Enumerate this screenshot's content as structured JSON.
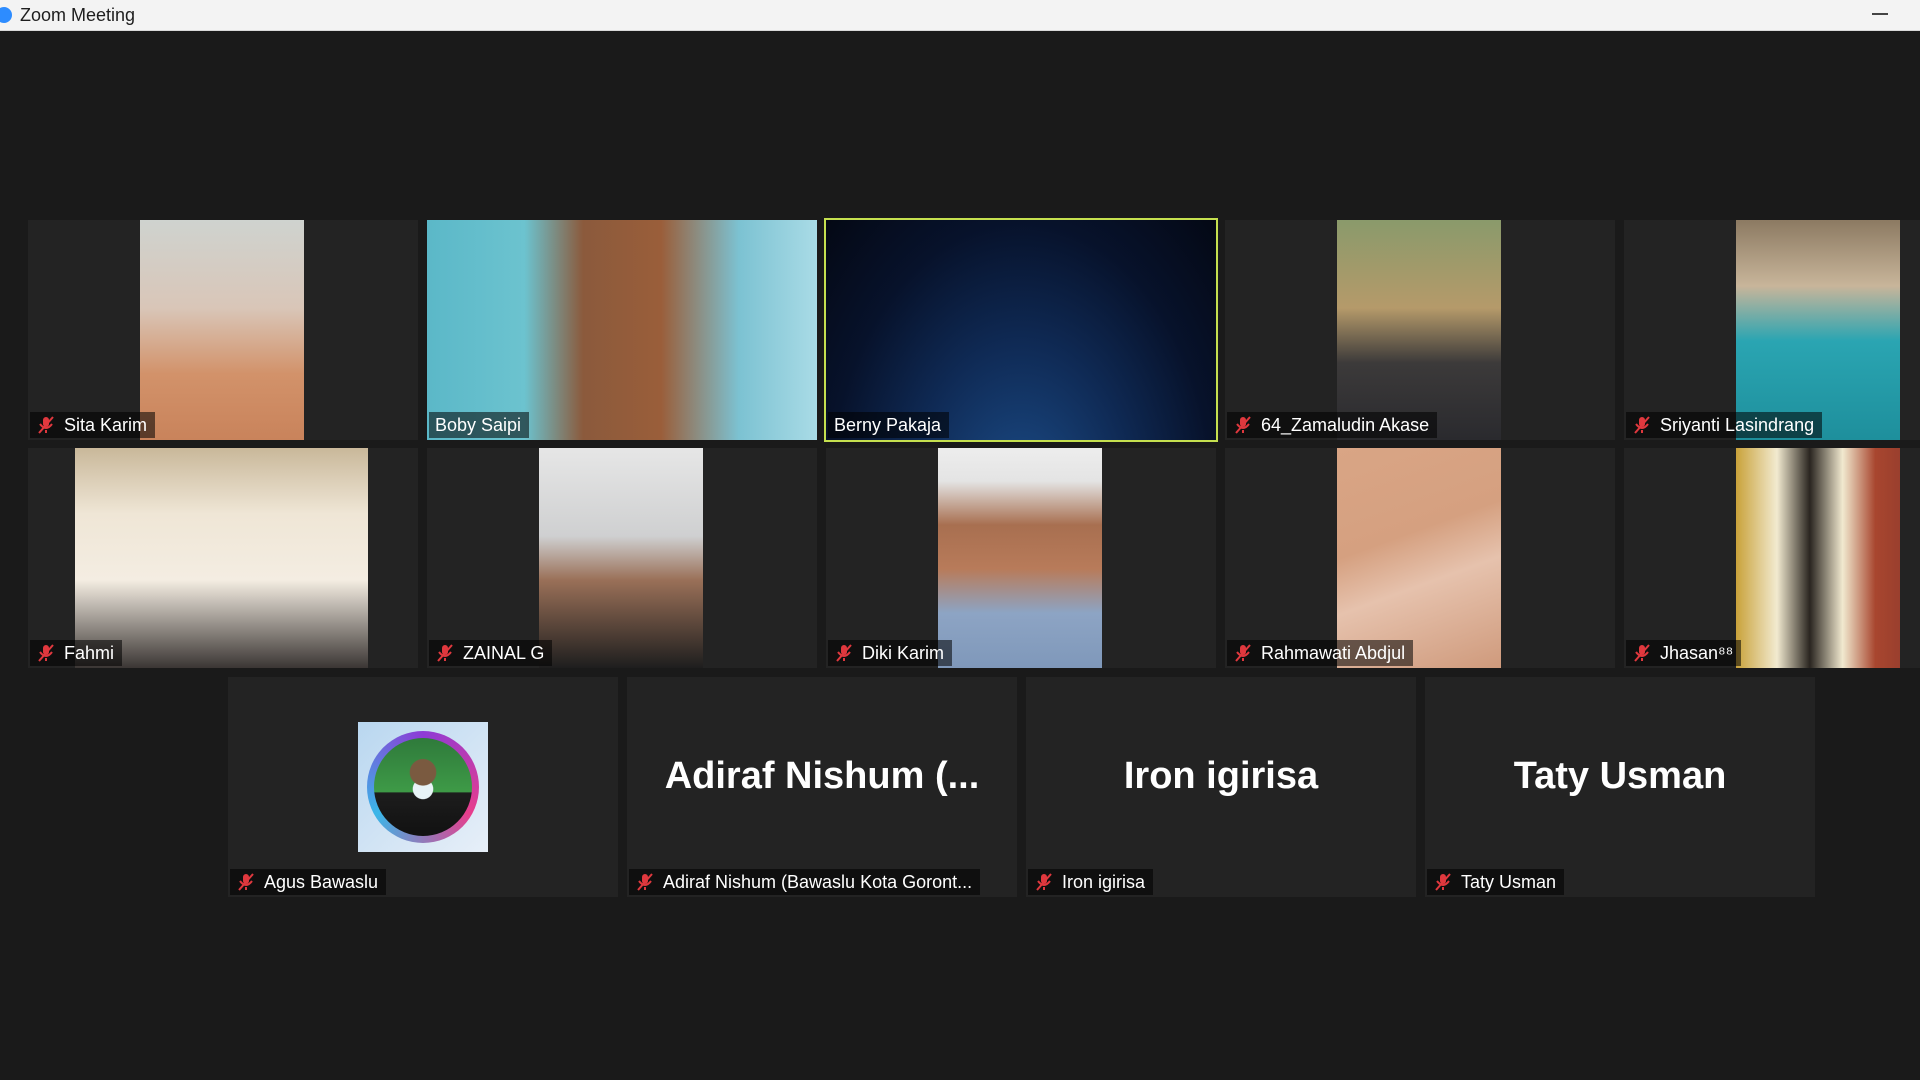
{
  "window": {
    "title": "Zoom Meeting"
  },
  "participants_row1": [
    {
      "name": "Sita Karim",
      "muted": true
    },
    {
      "name": "Boby Saipi",
      "muted": false
    },
    {
      "name": "Berny Pakaja",
      "muted": false,
      "speaking": true
    },
    {
      "name": "64_Zamaludin Akase",
      "muted": true
    },
    {
      "name": "Sriyanti Lasindrang",
      "muted": true
    }
  ],
  "participants_row2": [
    {
      "name": "Fahmi",
      "muted": true
    },
    {
      "name": "ZAINAL G",
      "muted": true
    },
    {
      "name": "Diki Karim",
      "muted": true
    },
    {
      "name": "Rahmawati Abdjul",
      "muted": true
    },
    {
      "name": "Jhasan⁸⁸",
      "muted": true
    }
  ],
  "participants_row3": [
    {
      "name": "Agus Bawaslu",
      "muted": true,
      "video": "avatar"
    },
    {
      "name": "Adiraf Nishum (Bawaslu Kota Goront...",
      "display_name": "Adiraf Nishum (...",
      "muted": true,
      "video": "off"
    },
    {
      "name": "Iron igirisa",
      "display_name": "Iron igirisa",
      "muted": true,
      "video": "off"
    },
    {
      "name": "Taty Usman",
      "display_name": "Taty Usman",
      "muted": true,
      "video": "off"
    }
  ],
  "colors": {
    "background": "#1a1a1a",
    "tile": "#232323",
    "active_speaker_border": "#c5e04f",
    "mute_icon": "#e0383e"
  }
}
